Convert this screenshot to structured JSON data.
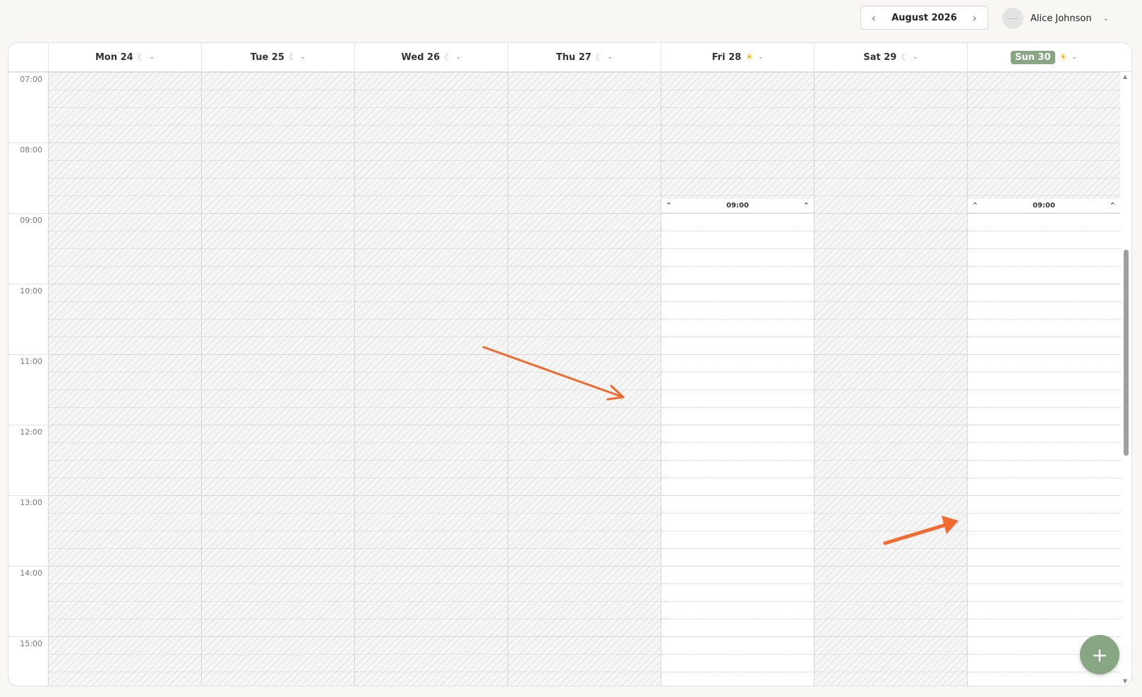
{
  "header": {
    "month_label": "August 2026",
    "prev_icon": "chevron-left-icon",
    "next_icon": "chevron-right-icon"
  },
  "user": {
    "name": "Alice Johnson",
    "avatar_icon": "avatar-icon",
    "chevron_icon": "chevron-down-icon"
  },
  "days": [
    {
      "label": "Mon 24",
      "weather": "moon",
      "today": false,
      "hatched_until_hour": null
    },
    {
      "label": "Tue 25",
      "weather": "moon",
      "today": false,
      "hatched_until_hour": null
    },
    {
      "label": "Wed 26",
      "weather": "moon",
      "today": false,
      "hatched_until_hour": null
    },
    {
      "label": "Thu 27",
      "weather": "moon",
      "today": false,
      "hatched_until_hour": null
    },
    {
      "label": "Fri 28",
      "weather": "sun",
      "today": false,
      "hatched_until_hour": 9,
      "availability_start": "09:00"
    },
    {
      "label": "Sat 29",
      "weather": "moon",
      "today": false,
      "hatched_until_hour": null
    },
    {
      "label": "Sun 30",
      "weather": "sun",
      "today": true,
      "hatched_until_hour": 9,
      "availability_start": "09:00"
    }
  ],
  "time_labels": [
    "07:00",
    "08:00",
    "09:00",
    "10:00",
    "11:00",
    "12:00",
    "13:00",
    "14:00",
    "15:00"
  ],
  "fab": {
    "label": "+",
    "icon": "plus-icon"
  },
  "colors": {
    "accent": "#88a584",
    "annotation_arrow": "#f26a2e",
    "sun": "#f0b400"
  }
}
